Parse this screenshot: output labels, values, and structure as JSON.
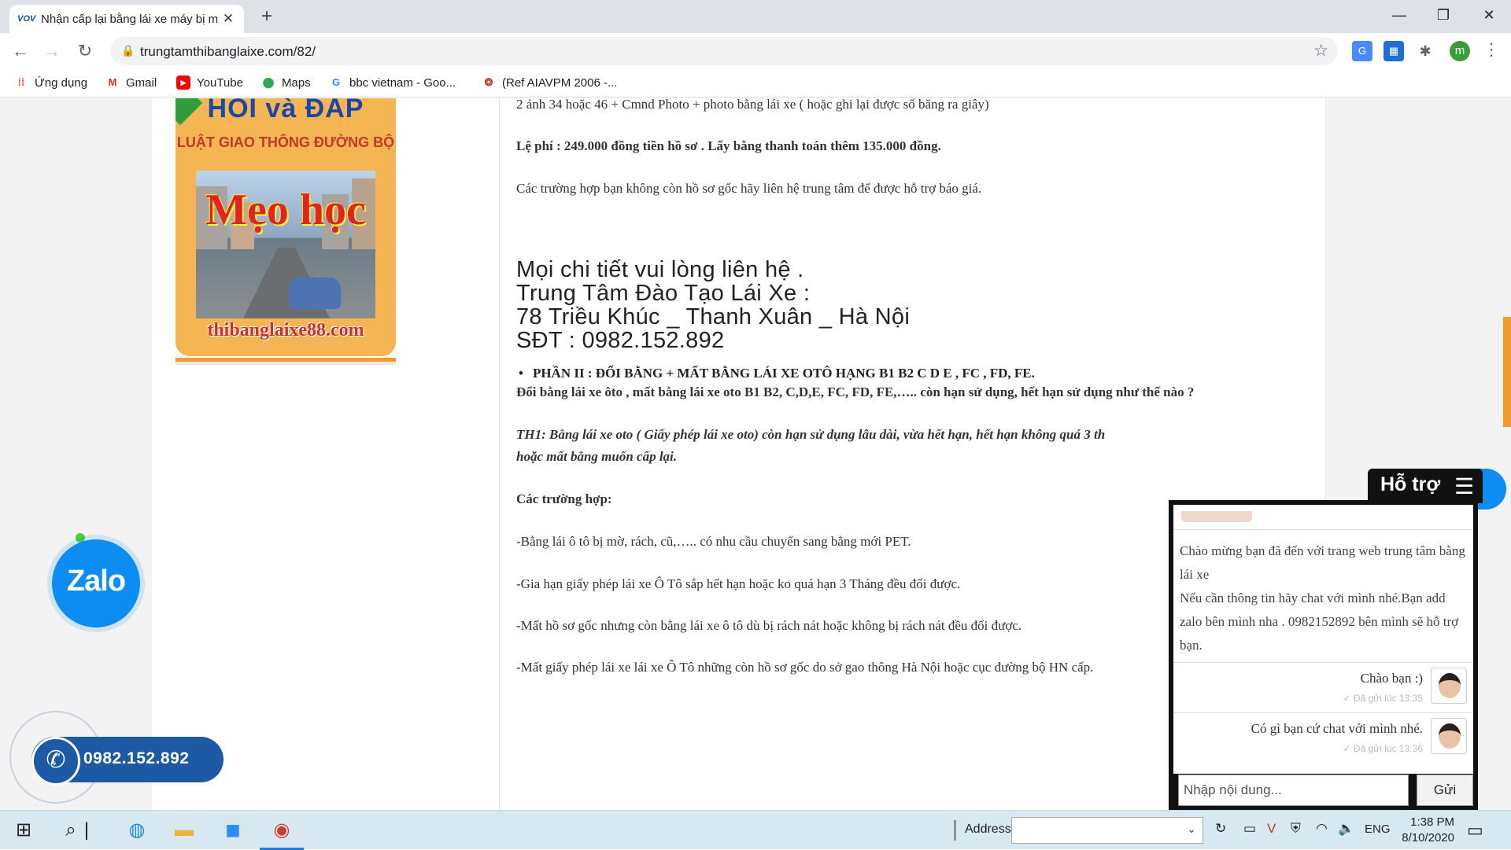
{
  "browser": {
    "tab_title": "Nhận cấp lại bằng lái xe máy bị m",
    "tab_favicon": "VOV",
    "url": "trungtamthibanglaixe.com/82/",
    "profile_initial": "m",
    "bookmarks": [
      {
        "label": "Ứng dụng",
        "icon": "apps-grid-icon"
      },
      {
        "label": "Gmail",
        "icon": "gmail-icon"
      },
      {
        "label": "YouTube",
        "icon": "youtube-icon"
      },
      {
        "label": "Maps",
        "icon": "maps-icon"
      },
      {
        "label": "bbc vietnam - Goo...",
        "icon": "google-icon"
      },
      {
        "label": "(Ref AIAVPM 2006 -...",
        "icon": "site-icon"
      }
    ]
  },
  "sidebar_image": {
    "title": "HỎI và ĐÁP",
    "subtitle": "LUẬT GIAO THÔNG ĐƯỜNG BỘ",
    "headline": "Mẹo học",
    "site": "thibanglaixe88.com"
  },
  "article": {
    "line_docs": "2 ảnh 34 hoặc 46 + Cmnd Photo + photo bằng lái xe ( hoặc ghi lại được số băng ra giây)",
    "line_fee": "Lệ phí : 249.000 đồng tiền hồ sơ . Lấy bằng thanh toán thêm 135.000 đồng.",
    "line_no_file": "Các trường hợp bạn không còn hồ sơ gốc hãy liên hệ trung tâm để được hỗ trợ báo giá.",
    "contact": [
      "Mọi chi tiết vui lòng liên hệ .",
      "Trung Tâm Đào Tạo Lái Xe  :",
      "78 Triều Khúc _ Thanh Xuân _ Hà Nội",
      "SĐT : 0982.152.892"
    ],
    "section2": "PHẦN II : ĐỔI BẰNG + MẤT BẰNG LÁI XE OTÔ HẠNG B1 B2 C D E , FC , FD, FE.",
    "question": "Đổi bằng lái xe ôto , mất bằng lái xe oto B1 B2, C,D,E, FC, FD, FE,…..  còn hạn sử dụng, hết hạn sử dụng như thế nào ?",
    "th1_line1": "TH1: Bằng lái xe oto ( Giấy phép lái xe oto) còn hạn sử dụng lâu dài, vừa hết hạn, hết hạn không quá 3 th",
    "th1_line2": "hoặc mất bằng muốn cấp lại.",
    "cases_title": "Các trường hợp:",
    "case1": "-Bằng lái ô tô bị mờ, rách, cũ,….. có nhu cầu chuyển sang bằng mới PET.",
    "case2": "-Gia hạn giấy phép lái xe Ô Tô sắp hết hạn hoặc ko quá hạn 3 Tháng đều đổi được.",
    "case3": "-Mất hồ sơ gốc nhưng còn bằng lái xe ô tô dù bị rách nát hoặc không bị rách nát đều đổi được.",
    "case4": "-Mất giấy phép lái xe lái xe Ô Tô những còn hồ sơ gốc do sở gao thông Hà Nội  hoặc cục đường bộ HN cấp."
  },
  "widgets": {
    "zalo_label": "Zalo",
    "phone_number": "0982.152.892"
  },
  "chat": {
    "header": "Hỗ trợ",
    "welcome": "Chào mừng bạn đã đến với trang web trung tâm bằng lái xe\nNếu cần thông tin hãy chat với mình nhé.Bạn add zalo bên mình nha . 0982152892 bên mình sẽ hỗ trợ bạn.",
    "messages": [
      {
        "text": "Chào bạn :)",
        "meta": "✓ Đã gửi lúc 13:35"
      },
      {
        "text": "Có gì bạn cứ chat với mình nhé.",
        "meta": "✓ Đã gửi lúc 13:36"
      }
    ],
    "input_placeholder": "Nhập nội dung...",
    "send_label": "Gửi"
  },
  "taskbar": {
    "address_label": "Address",
    "language": "ENG",
    "time": "1:38 PM",
    "date": "8/10/2020"
  },
  "colors": {
    "accent_orange": "#f29a2e",
    "zalo_blue": "#0d8cf1",
    "phone_blue": "#1c5aa6"
  }
}
